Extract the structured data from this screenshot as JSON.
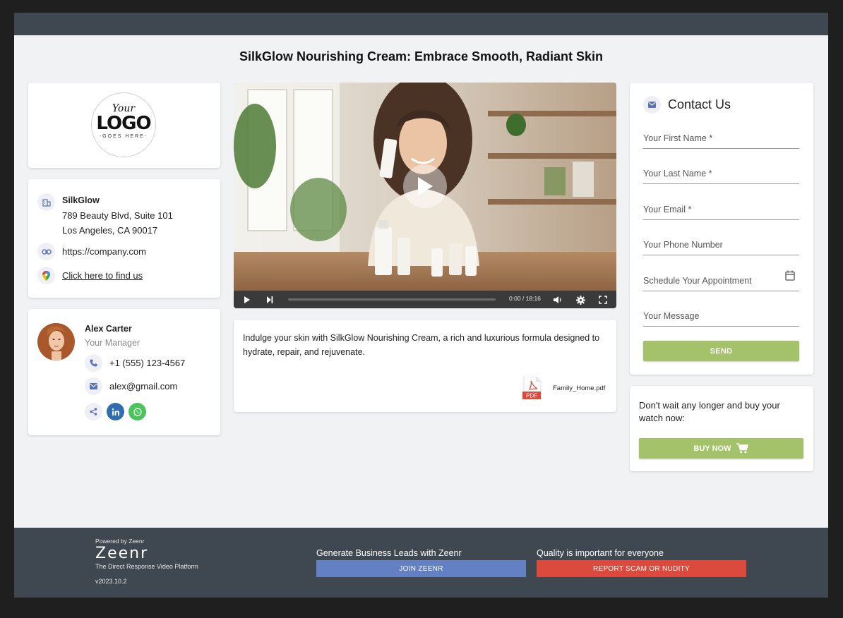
{
  "page": {
    "title": "SilkGlow Nourishing Cream: Embrace Smooth, Radiant Skin"
  },
  "logo": {
    "line1": "Your",
    "line2": "LOGO",
    "line3": "-GOES HERE-"
  },
  "company": {
    "name": "SilkGlow",
    "address_line1": "789 Beauty Blvd, Suite 101",
    "address_line2": "Los Angeles, CA 90017",
    "website": "https://company.com",
    "map_link": "Click here to find us"
  },
  "manager": {
    "name": "Alex Carter",
    "role": "Your Manager",
    "phone": "+1 (555) 123-4567",
    "email": "alex@gmail.com"
  },
  "video": {
    "time": "0:00 / 18:16",
    "progress_fraction": 0
  },
  "description": {
    "text": "Indulge your skin with SilkGlow Nourishing Cream, a rich and luxurious formula designed to hydrate, repair, and rejuvenate.",
    "attachment": "Family_Home.pdf",
    "attachment_badge": "PDF"
  },
  "contact": {
    "title": "Contact Us",
    "first_name_placeholder": "Your First Name *",
    "last_name_placeholder": "Your Last Name *",
    "email_placeholder": "Your Email *",
    "phone_placeholder": "Your Phone Number",
    "appointment_placeholder": "Schedule Your Appointment",
    "message_placeholder": "Your Message",
    "send_label": "SEND"
  },
  "buy": {
    "text": "Don't wait any longer and buy your watch now:",
    "button_label": "BUY NOW"
  },
  "footer": {
    "powered_by": "Powered by Zeenr",
    "brand": "Zeenr",
    "tagline": "The Direct Response Video Platform",
    "version": "v2023.10.2",
    "leads_label": "Generate Business Leads with Zeenr",
    "join_label": "JOIN ZEENR",
    "quality_label": "Quality is important for everyone",
    "report_label": "REPORT SCAM OR NUDITY"
  },
  "colors": {
    "accent_green": "#a4c26a",
    "join_blue": "#6381c2",
    "report_red": "#dc4a3d",
    "footer_bg": "#3f4750",
    "icon_blue": "#5b73b8"
  }
}
